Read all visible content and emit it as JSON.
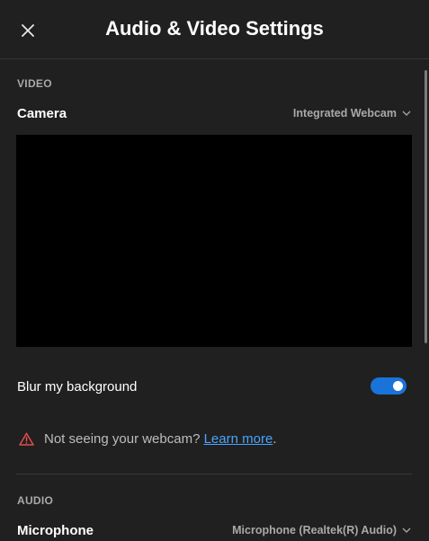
{
  "header": {
    "title": "Audio & Video Settings",
    "close_icon": "close-icon"
  },
  "video": {
    "section_label": "VIDEO",
    "camera_label": "Camera",
    "camera_value": "Integrated Webcam",
    "blur_label": "Blur my background",
    "blur_enabled": true,
    "warning_text": "Not seeing your webcam? ",
    "warning_link": "Learn more",
    "warning_suffix": ".",
    "warning_icon": "warning-triangle-icon",
    "warning_color": "#e24c4c"
  },
  "audio": {
    "section_label": "AUDIO",
    "microphone_label": "Microphone",
    "microphone_value": "Microphone (Realtek(R) Audio)"
  },
  "colors": {
    "background": "#202020",
    "accent": "#1a73d8",
    "link": "#4aa3ff"
  }
}
